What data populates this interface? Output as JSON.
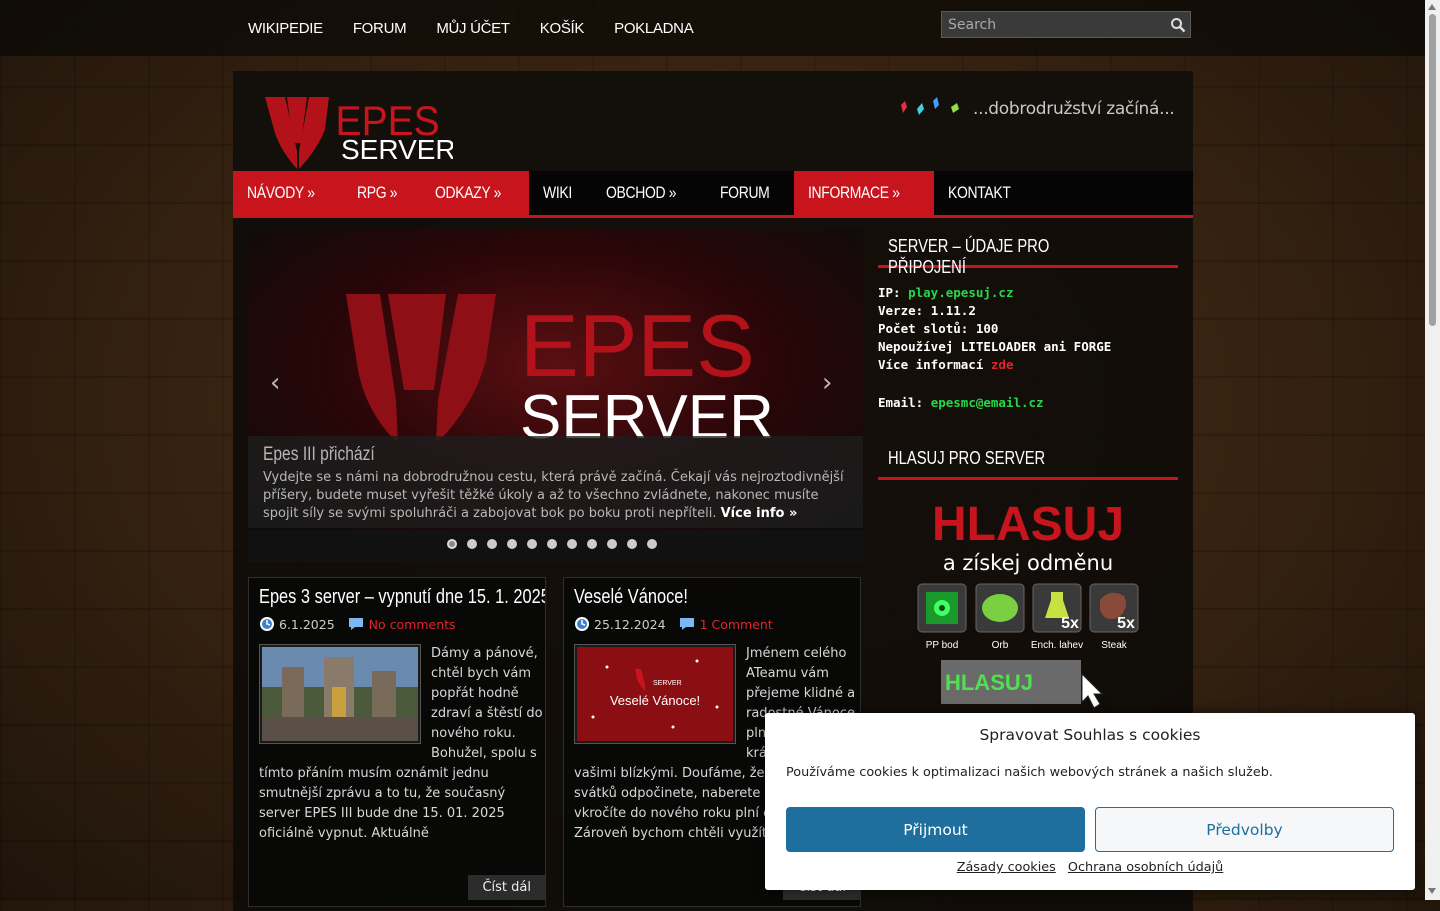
{
  "top_menu": [
    "WIKIPEDIE",
    "FORUM",
    "MŮJ ÚČET",
    "KOŠÍK",
    "POKLADNA"
  ],
  "search": {
    "placeholder": "Search"
  },
  "header": {
    "logo_top": "EPES",
    "logo_bottom": "SERVER",
    "tagline": "...dobrodružství začíná..."
  },
  "main_nav": [
    "NÁVODY »",
    "RPG »",
    "ODKAZY »",
    "WIKI",
    "OBCHOD »",
    "FORUM",
    "INFORMACE »",
    "KONTAKT"
  ],
  "slider": {
    "logo_top": "EPES",
    "logo_bottom": "SERVER",
    "title": "Epes III přichází",
    "text": "Vydejte se s námi na dobrodružnou cestu, která právě začíná. Čekají vás nejroztodivnější příšery, budete muset vyřešit těžké úkoly a až to všechno zvládnete, nakonec musíte spojit síly se svými spoluhráči a zabojovat bok po boku proti nepříteli.",
    "more": "Více info »",
    "prev": "‹",
    "next": "›",
    "active_slide": 1,
    "slide_count": 11
  },
  "posts": [
    {
      "title": "Epes 3 server – vypnutí dne 15. 1. 2025",
      "date": "6.1.2025",
      "comments": "No comments",
      "body": "Dámy a pánové, chtěl bych vám popřát hodně zdraví a štěstí do nového roku. Bohužel, spolu s tímto přáním musím oznámit jednu smutnější zprávu a to tu, že současný server EPES III bude dne 15. 01. 2025 oficiálně vypnut. Aktuálně",
      "read_more": "Číst dál"
    },
    {
      "title": "Veselé Vánoce!",
      "date": "25.12.2024",
      "comments": "1 Comment",
      "thumb_brand": "SERVER",
      "thumb_text": "Veselé Vánoce!",
      "body": "Jménem celého ATeamu vám přejeme klidné a radostné Vánoce plné odpočinku a krásných chvil s vašimi blízkými. Doufáme, že si během svátků odpočinete, naberete nové síly a vkročíte do nového roku plní energie. Zároveň bychom chtěli využít příležitosti",
      "read_more": "Číst dál"
    }
  ],
  "sidebar": {
    "server_widget_title": "SERVER – ÚDAJE PRO PŘIPOJENÍ",
    "ip_label": "IP:",
    "ip_value": "play.epesuj.cz",
    "version_label": "Verze:",
    "version_value": "1.11.2",
    "slots_label": "Počet slotů:",
    "slots_value": "100",
    "warning": "Nepoužívej LITELOADER ani FORGE",
    "more_label": "Více informací",
    "more_link": "zde",
    "email_label": "Email:",
    "email_value": "epesmc@email.cz",
    "vote_widget_title": "HLASUJ PRO SERVER",
    "vote_heading": "HLASUJ",
    "vote_sub": "a získej odměnu",
    "rewards": [
      {
        "label": "PP bod",
        "badge": ""
      },
      {
        "label": "Orb",
        "badge": ""
      },
      {
        "label": "Ench. lahev",
        "badge": "5x"
      },
      {
        "label": "Steak",
        "badge": "5x"
      }
    ],
    "vote_button": "HLASUJ"
  },
  "cookie": {
    "title": "Spravovat Souhlas s cookies",
    "text": "Používáme cookies k optimalizaci našich webových stránek a našich služeb.",
    "accept": "Přijmout",
    "prefs": "Předvolby",
    "link1": "Zásady cookies",
    "link2": "Ochrana osobních údajů"
  },
  "colors": {
    "accent": "#c8141c",
    "link_green": "#27d84a",
    "cookie_blue": "#1e6e9e"
  }
}
